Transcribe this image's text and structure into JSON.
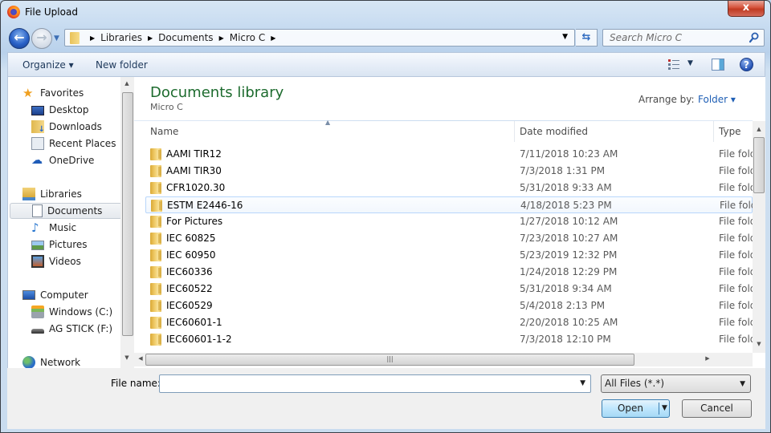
{
  "window": {
    "title": "File Upload",
    "close_label": "x"
  },
  "nav": {
    "back_icon": "back-arrow-icon",
    "forward_icon": "forward-arrow-icon",
    "breadcrumb": [
      "Libraries",
      "Documents",
      "Micro C"
    ],
    "search_placeholder": "Search Micro C"
  },
  "toolbar": {
    "organize_label": "Organize ▾",
    "new_folder_label": "New folder",
    "help_label": "?"
  },
  "sidebar": {
    "groups": [
      {
        "label": "Favorites",
        "icon": "star-icon",
        "items": [
          {
            "label": "Desktop",
            "icon": "desktop-icon"
          },
          {
            "label": "Downloads",
            "icon": "downloads-icon"
          },
          {
            "label": "Recent Places",
            "icon": "recent-places-icon"
          },
          {
            "label": "OneDrive",
            "icon": "onedrive-icon"
          }
        ]
      },
      {
        "label": "Libraries",
        "icon": "libraries-icon",
        "items": [
          {
            "label": "Documents",
            "icon": "documents-icon",
            "selected": true
          },
          {
            "label": "Music",
            "icon": "music-icon"
          },
          {
            "label": "Pictures",
            "icon": "pictures-icon"
          },
          {
            "label": "Videos",
            "icon": "videos-icon"
          }
        ]
      },
      {
        "label": "Computer",
        "icon": "computer-icon",
        "items": [
          {
            "label": "Windows (C:)",
            "icon": "drive-icon"
          },
          {
            "label": "AG STICK (F:)",
            "icon": "usb-drive-icon"
          }
        ]
      },
      {
        "label": "Network",
        "icon": "network-icon",
        "items": []
      }
    ]
  },
  "content": {
    "library_title": "Documents library",
    "library_subtitle": "Micro C",
    "arrange_label": "Arrange by:",
    "arrange_value": "Folder ▾",
    "columns": [
      "Name",
      "Date modified",
      "Type"
    ],
    "rows": [
      {
        "name": "AAMI TIR12",
        "date": "7/11/2018 10:23 AM",
        "type": "File folder"
      },
      {
        "name": "AAMI TIR30",
        "date": "7/3/2018 1:31 PM",
        "type": "File folder"
      },
      {
        "name": "CFR1020.30",
        "date": "5/31/2018 9:33 AM",
        "type": "File folder"
      },
      {
        "name": "ESTM E2446-16",
        "date": "4/18/2018 5:23 PM",
        "type": "File folder",
        "hover": true
      },
      {
        "name": "For Pictures",
        "date": "1/27/2018 10:12 AM",
        "type": "File folder"
      },
      {
        "name": "IEC 60825",
        "date": "7/23/2018 10:27 AM",
        "type": "File folder"
      },
      {
        "name": "IEC 60950",
        "date": "5/23/2019 12:32 PM",
        "type": "File folder"
      },
      {
        "name": "IEC60336",
        "date": "1/24/2018 12:29 PM",
        "type": "File folder"
      },
      {
        "name": "IEC60522",
        "date": "5/31/2018 9:34 AM",
        "type": "File folder"
      },
      {
        "name": "IEC60529",
        "date": "5/4/2018 2:13 PM",
        "type": "File folder"
      },
      {
        "name": "IEC60601-1",
        "date": "2/20/2018 10:25 AM",
        "type": "File folder"
      },
      {
        "name": "IEC60601-1-2",
        "date": "7/3/2018 12:10 PM",
        "type": "File folder"
      }
    ]
  },
  "footer": {
    "file_name_label": "File name:",
    "file_name_value": "",
    "filter_value": "All Files (*.*)",
    "open_label": "Open",
    "cancel_label": "Cancel"
  }
}
